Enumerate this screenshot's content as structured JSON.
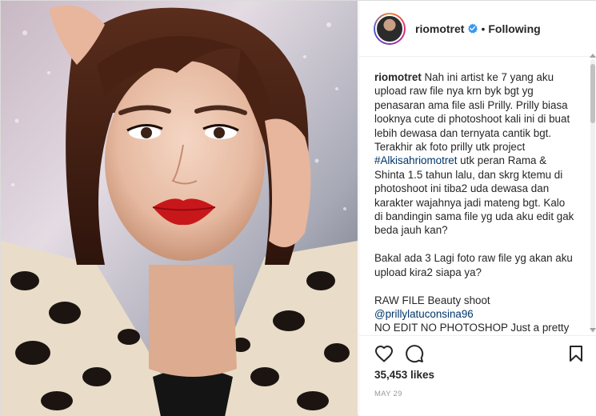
{
  "header": {
    "username": "riomotret",
    "separator": "•",
    "follow_status": "Following"
  },
  "caption": {
    "username": "riomotret",
    "text_1": " Nah ini artist ke 7 yang aku upload raw file nya krn byk bgt yg penasaran ama file asli Prilly. Prilly biasa looknya cute di photoshoot kali ini di buat lebih dewasa dan ternyata cantik bgt. Terakhir ak foto prilly utk project ",
    "hashtag": "#Alkisahriomotret",
    "text_2": " utk peran Rama & Shinta 1.5 tahun lalu, dan skrg ktemu di photoshoot ini tiba2 uda dewasa dan karakter wajahnya jadi mateng bgt. Kalo di bandingin sama file yg uda aku edit gak beda jauh kan?\n\nBakal ada 3 Lagi foto raw file yg akan aku upload kira2 siapa ya?\n\nRAW FILE Beauty shoot\n",
    "mention": "@prillylatuconsina96",
    "text_3": "\nNO EDIT NO PHOTOSHOP Just a pretty model, a flawless make up, a proper"
  },
  "stats": {
    "likes": "35,453 likes",
    "date": "MAY 29"
  },
  "icons": {
    "like": "heart-icon",
    "comment": "comment-icon",
    "save": "bookmark-icon",
    "verified": "verified-badge-icon"
  },
  "colors": {
    "verified": "#3897f0",
    "link": "#003569",
    "text": "#262626",
    "muted": "#999999"
  }
}
